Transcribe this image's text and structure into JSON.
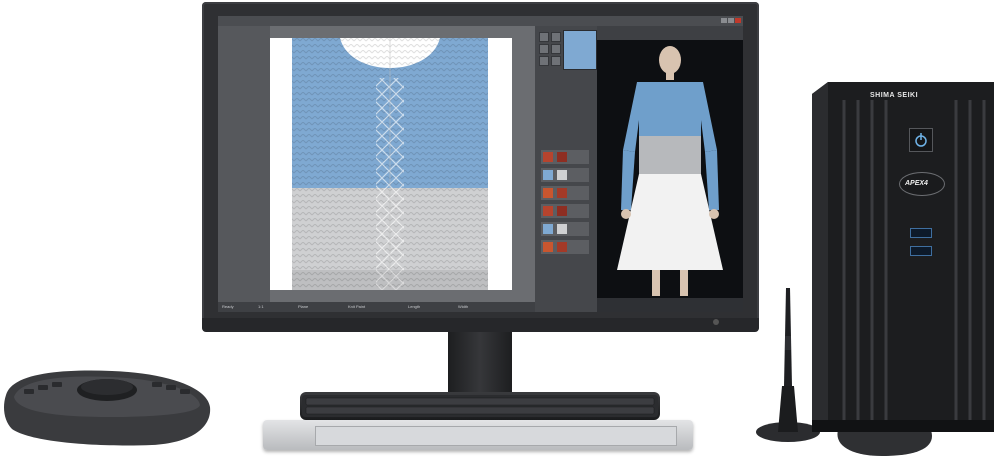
{
  "tower": {
    "brand": "SHIMA SEIKI",
    "model": "APEX4",
    "power_icon": "power-icon",
    "ports": [
      "usb-port",
      "usb-port"
    ]
  },
  "screen": {
    "status_items": [
      "Ready",
      "1:1",
      "Plane",
      "Knit Paint",
      "Length",
      "Width"
    ],
    "pattern_colors": {
      "top": "#7fa9d2",
      "bottom": "#cfd0d2",
      "cable": "#a9c4df"
    },
    "preview_colors": {
      "top": "#6f9fcb",
      "bottom": "#b7b9bc",
      "skirt": "#f2f2f2"
    },
    "swatch_colors": [
      "#b6442e",
      "#8e2e22",
      "#7fa9d2",
      "#cfd0d2",
      "#c8562f",
      "#a33a28"
    ]
  },
  "accents": {
    "bezel": "#2f3033",
    "ui_panel": "#45474b",
    "preview_bg": "#0d0f12"
  }
}
